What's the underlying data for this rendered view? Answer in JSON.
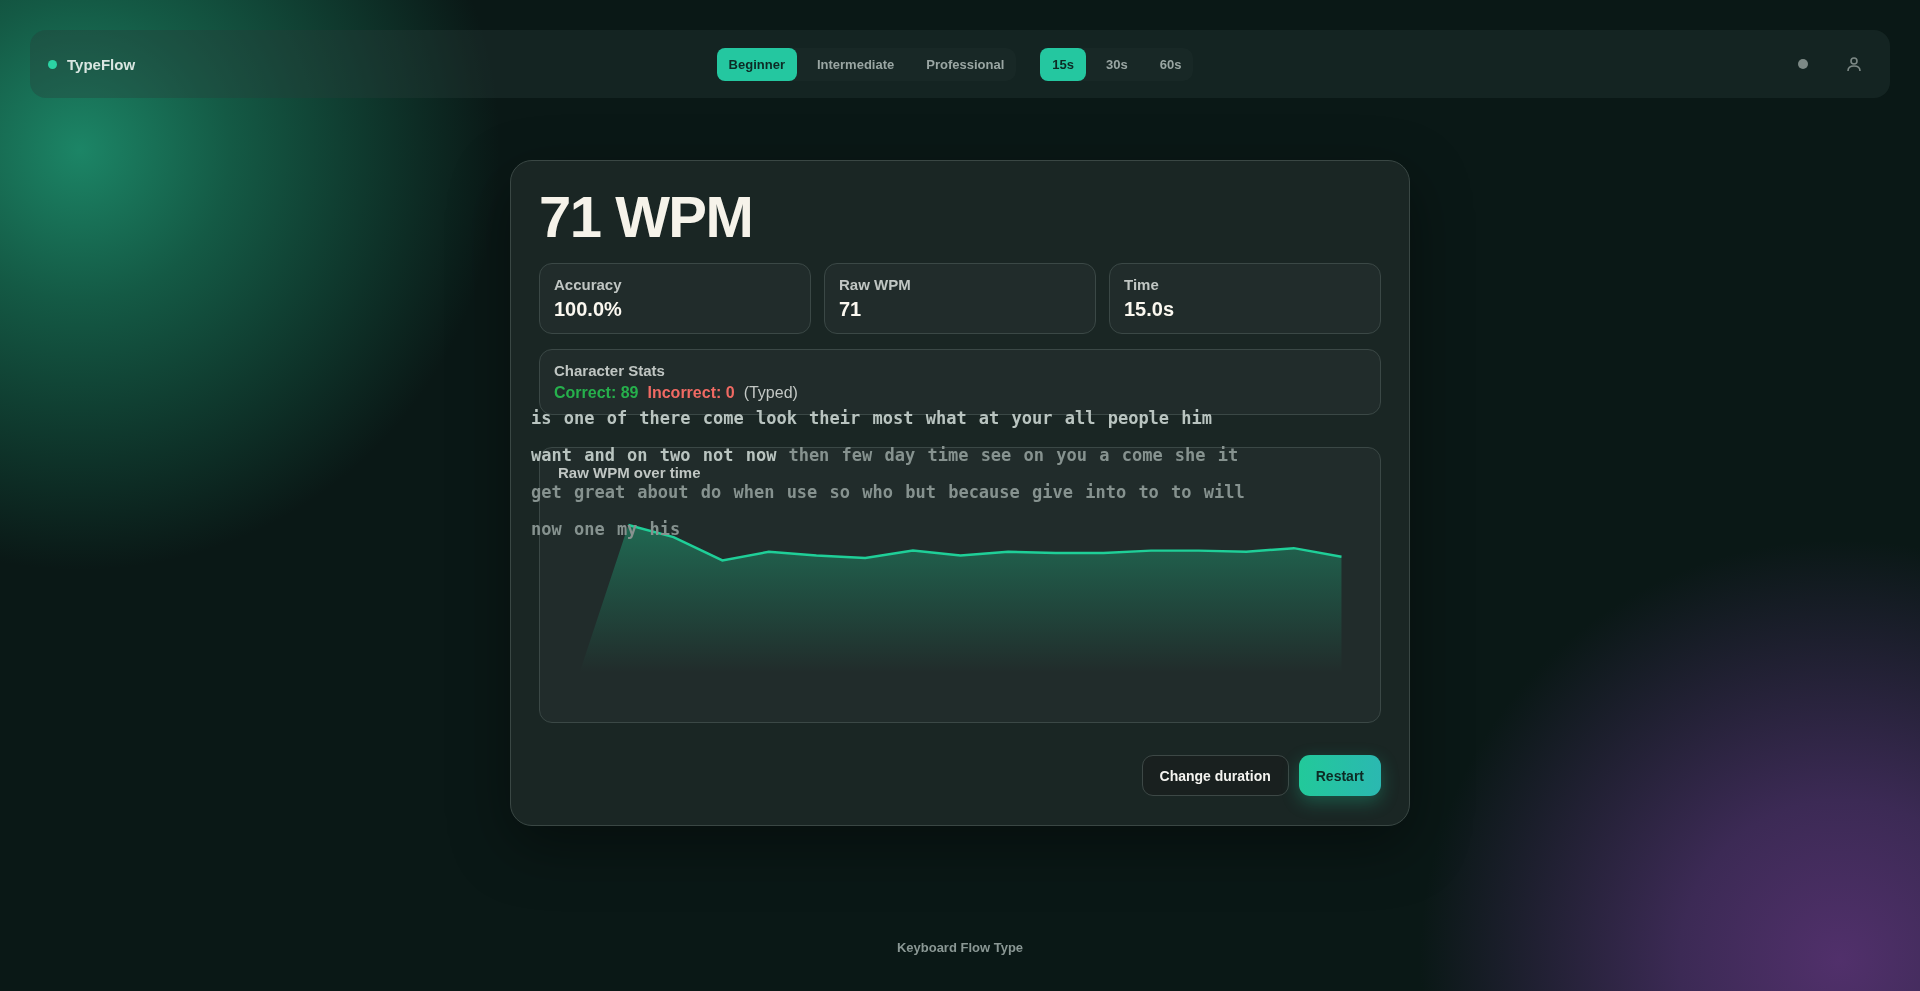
{
  "nav": {
    "logo": "TypeFlow",
    "modes": [
      {
        "label": "Beginner",
        "selected": true
      },
      {
        "label": "Intermediate",
        "selected": false
      },
      {
        "label": "Professional",
        "selected": false
      }
    ],
    "durations": [
      {
        "label": "15s",
        "selected": true
      },
      {
        "label": "30s",
        "selected": false
      },
      {
        "label": "60s",
        "selected": false
      }
    ]
  },
  "typing": {
    "lines": [
      {
        "typed": "is one of there come look their most what at your all people him"
      },
      {
        "typed": "want and on two not now",
        "untyped": "then few day time see on you a come she it"
      },
      {
        "untyped": "get great about do when use so who but because give into to to will"
      },
      {
        "untyped": "now one my his"
      }
    ]
  },
  "result": {
    "wpm": "71 WPM",
    "stats": [
      {
        "label": "Accuracy",
        "value": "100.0%"
      },
      {
        "label": "Raw WPM",
        "value": "71"
      },
      {
        "label": "Time",
        "value": "15.0s"
      }
    ],
    "character_stats": {
      "title": "Character Stats",
      "correct": "Correct: 89",
      "incorrect": "Incorrect: 0",
      "note": "(Typed)"
    },
    "chart_title": "Raw WPM over time",
    "buttons": [
      {
        "label": "Change duration",
        "kind": "secondary"
      },
      {
        "label": "Restart",
        "kind": "primary"
      }
    ]
  },
  "footer": "Keyboard Flow Type"
}
